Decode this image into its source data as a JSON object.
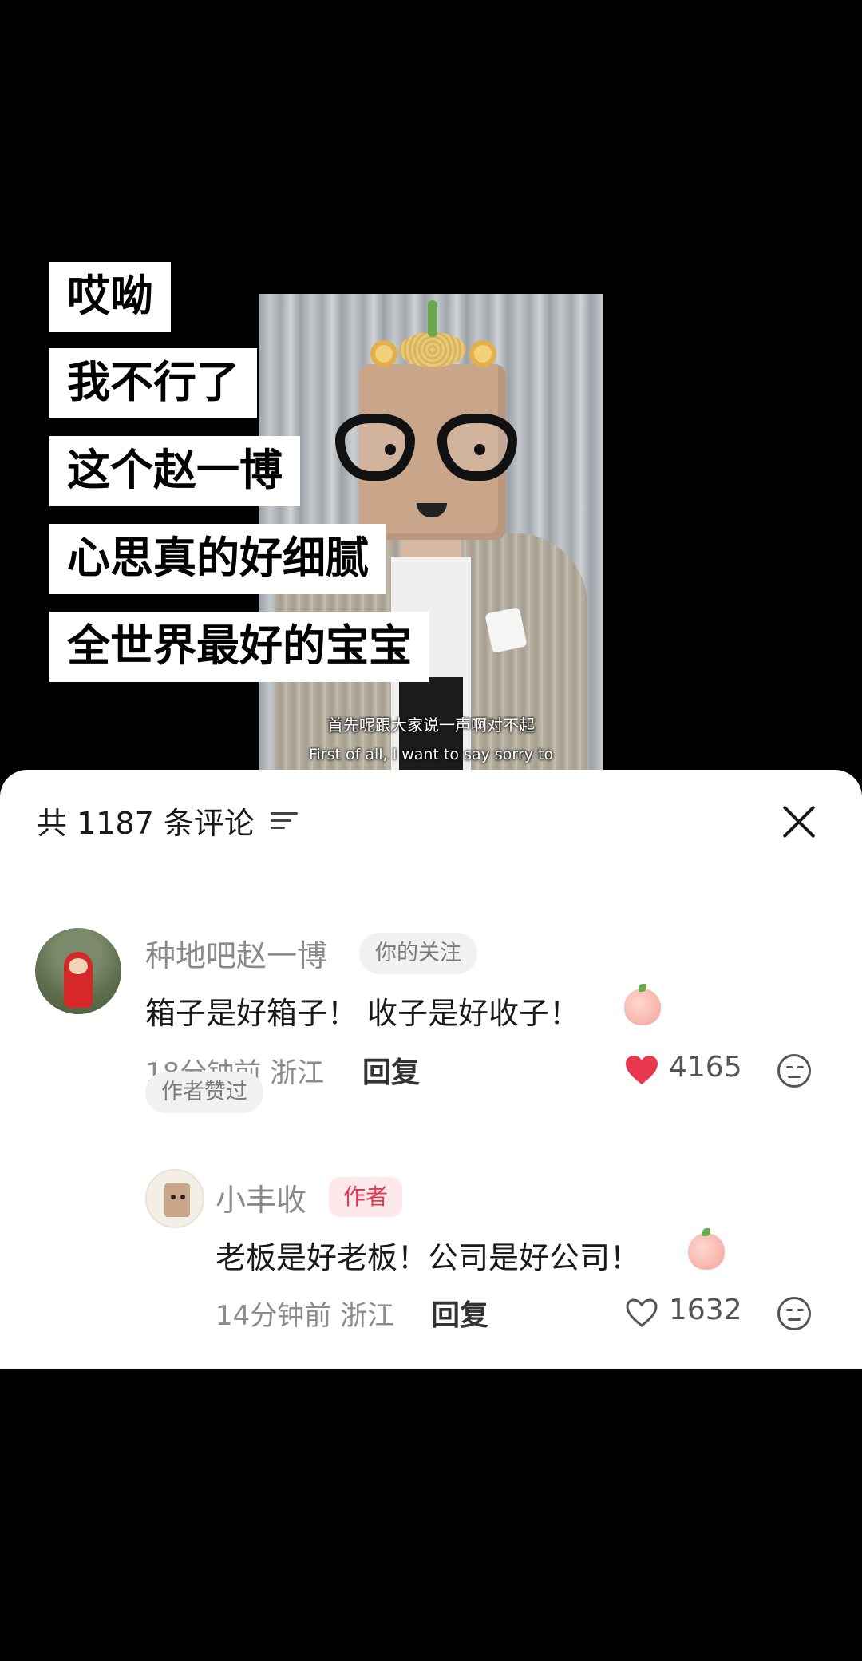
{
  "video": {
    "captions": [
      "哎呦",
      "我不行了",
      "这个赵一博",
      "心思真的好细腻",
      "全世界最好的宝宝"
    ],
    "subtitle_cn": "首先呢跟大家说一声啊对不起",
    "subtitle_en": "First of all, I want to say sorry to"
  },
  "comments_header": {
    "count_text": "共 1187 条评论",
    "sort_icon": "sort-lines-icon",
    "close_icon": "close-x-icon"
  },
  "comments": [
    {
      "username": "种地吧赵一博",
      "tag": "你的关注",
      "text": "箱子是好箱子！ 收子是好收子！",
      "emoji": "peach-blush-emoji",
      "time_location": "18分钟前 浙江",
      "reply_label": "回复",
      "likes": "4165",
      "liked": true,
      "badge": "作者赞过"
    },
    {
      "username": "小丰收",
      "tag": "作者",
      "text": "老板是好老板！公司是好公司！",
      "emoji": "peach-cry-emoji",
      "time_location": "14分钟前 浙江",
      "reply_label": "回复",
      "likes": "1632",
      "liked": false
    }
  ],
  "colors": {
    "like_red": "#e8384f",
    "author_tag_bg": "#fde8ec",
    "tag_bg": "#f1f1f1",
    "meta_gray": "#8c8c8c"
  }
}
